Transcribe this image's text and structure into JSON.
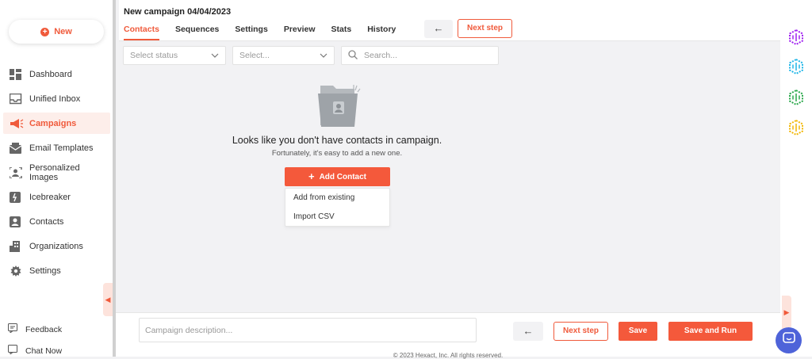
{
  "sidebar": {
    "new_label": "New",
    "items": [
      {
        "label": "Dashboard"
      },
      {
        "label": "Unified Inbox"
      },
      {
        "label": "Campaigns"
      },
      {
        "label": "Email Templates"
      },
      {
        "label": "Personalized Images"
      },
      {
        "label": "Icebreaker"
      },
      {
        "label": "Contacts"
      },
      {
        "label": "Organizations"
      },
      {
        "label": "Settings"
      }
    ],
    "feedback_label": "Feedback",
    "chat_label": "Chat Now"
  },
  "header": {
    "title": "New campaign 04/04/2023",
    "tabs": [
      {
        "label": "Contacts"
      },
      {
        "label": "Sequences"
      },
      {
        "label": "Settings"
      },
      {
        "label": "Preview"
      },
      {
        "label": "Stats"
      },
      {
        "label": "History"
      }
    ],
    "back_label": "←",
    "next_label": "Next step"
  },
  "filters": {
    "status_placeholder": "Select status",
    "select_placeholder": "Select...",
    "search_placeholder": "Search..."
  },
  "empty_state": {
    "title": "Looks like you don't have contacts in campaign.",
    "subtitle": "Fortunately, it's easy to add a new one.",
    "add_contact_label": "Add Contact",
    "menu": [
      {
        "label": "Add from existing"
      },
      {
        "label": "Import CSV"
      }
    ]
  },
  "bottom": {
    "description_placeholder": "Campaign description...",
    "back_label": "←",
    "next_label": "Next step",
    "save_label": "Save",
    "save_run_label": "Save and Run",
    "copyright": "© 2023 Hexact, Inc. All rights reserved."
  },
  "colors": {
    "accent": "#f05a3b",
    "accent_light": "#fdeeea",
    "chat": "#4e63d9",
    "app_purple": "#a020f0",
    "app_cyan": "#1fb6e8",
    "app_green": "#2aa84a",
    "app_yellow": "#f2b705"
  }
}
